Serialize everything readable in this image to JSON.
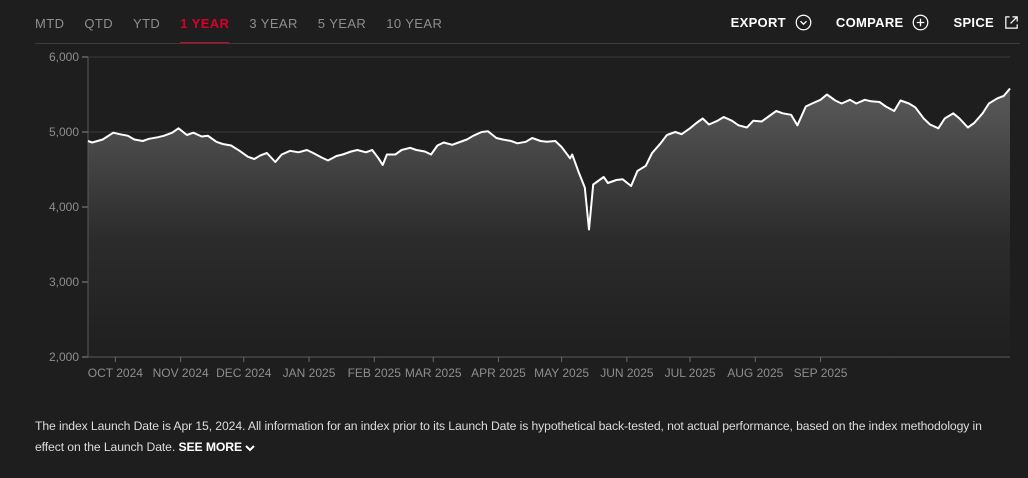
{
  "tabs": [
    {
      "label": "MTD",
      "active": false
    },
    {
      "label": "QTD",
      "active": false
    },
    {
      "label": "YTD",
      "active": false
    },
    {
      "label": "1 YEAR",
      "active": true
    },
    {
      "label": "3 YEAR",
      "active": false
    },
    {
      "label": "5 YEAR",
      "active": false
    },
    {
      "label": "10 YEAR",
      "active": false
    }
  ],
  "actions": [
    {
      "label": "EXPORT",
      "icon": "chevron-down-circle-icon"
    },
    {
      "label": "COMPARE",
      "icon": "plus-circle-icon"
    },
    {
      "label": "SPICE",
      "icon": "external-link-icon"
    }
  ],
  "colors": {
    "accent": "#d6002a",
    "line": "#ffffff",
    "background": "#1e1e1e"
  },
  "chart_data": {
    "type": "area",
    "title": "",
    "xlabel": "",
    "ylabel": "",
    "ylim": [
      2000,
      6000
    ],
    "yticks": [
      2000,
      3000,
      4000,
      5000,
      6000
    ],
    "ytick_labels": [
      "2,000",
      "3,000",
      "4,000",
      "5,000",
      "6,000"
    ],
    "xticks": [
      {
        "label": "OCT 2024",
        "date": "2024-10-01"
      },
      {
        "label": "NOV 2024",
        "date": "2024-11-01"
      },
      {
        "label": "DEC 2024",
        "date": "2024-12-01"
      },
      {
        "label": "JAN 2025",
        "date": "2025-01-01"
      },
      {
        "label": "FEB 2025",
        "date": "2025-02-01"
      },
      {
        "label": "MAR 2025",
        "date": "2025-03-01"
      },
      {
        "label": "APR 2025",
        "date": "2025-04-01"
      },
      {
        "label": "MAY 2025",
        "date": "2025-05-01"
      },
      {
        "label": "JUN 2025",
        "date": "2025-06-01"
      },
      {
        "label": "JUL 2025",
        "date": "2025-07-01"
      },
      {
        "label": "AUG 2025",
        "date": "2025-08-01"
      },
      {
        "label": "SEP 2025",
        "date": "2025-09-01"
      }
    ],
    "grid": "horizontal",
    "series": [
      {
        "points": [
          [
            "2024-09-18",
            4880
          ],
          [
            "2024-09-20",
            4860
          ],
          [
            "2024-09-25",
            4900
          ],
          [
            "2024-09-30",
            4990
          ],
          [
            "2024-10-03",
            4970
          ],
          [
            "2024-10-07",
            4950
          ],
          [
            "2024-10-10",
            4900
          ],
          [
            "2024-10-14",
            4880
          ],
          [
            "2024-10-17",
            4910
          ],
          [
            "2024-10-21",
            4930
          ],
          [
            "2024-10-24",
            4950
          ],
          [
            "2024-10-28",
            4990
          ],
          [
            "2024-10-31",
            5050
          ],
          [
            "2024-11-04",
            4960
          ],
          [
            "2024-11-07",
            4990
          ],
          [
            "2024-11-11",
            4940
          ],
          [
            "2024-11-14",
            4950
          ],
          [
            "2024-11-18",
            4870
          ],
          [
            "2024-11-21",
            4840
          ],
          [
            "2024-11-25",
            4820
          ],
          [
            "2024-11-29",
            4750
          ],
          [
            "2024-12-03",
            4670
          ],
          [
            "2024-12-06",
            4640
          ],
          [
            "2024-12-09",
            4690
          ],
          [
            "2024-12-12",
            4720
          ],
          [
            "2024-12-16",
            4600
          ],
          [
            "2024-12-19",
            4700
          ],
          [
            "2024-12-23",
            4750
          ],
          [
            "2024-12-27",
            4730
          ],
          [
            "2024-12-31",
            4760
          ],
          [
            "2025-01-03",
            4720
          ],
          [
            "2025-01-07",
            4660
          ],
          [
            "2025-01-10",
            4620
          ],
          [
            "2025-01-14",
            4680
          ],
          [
            "2025-01-17",
            4700
          ],
          [
            "2025-01-21",
            4740
          ],
          [
            "2025-01-24",
            4760
          ],
          [
            "2025-01-28",
            4730
          ],
          [
            "2025-01-31",
            4760
          ],
          [
            "2025-02-03",
            4650
          ],
          [
            "2025-02-05",
            4560
          ],
          [
            "2025-02-07",
            4700
          ],
          [
            "2025-02-11",
            4700
          ],
          [
            "2025-02-14",
            4760
          ],
          [
            "2025-02-18",
            4790
          ],
          [
            "2025-02-21",
            4760
          ],
          [
            "2025-02-25",
            4740
          ],
          [
            "2025-02-28",
            4700
          ],
          [
            "2025-03-03",
            4820
          ],
          [
            "2025-03-06",
            4860
          ],
          [
            "2025-03-10",
            4830
          ],
          [
            "2025-03-13",
            4860
          ],
          [
            "2025-03-17",
            4900
          ],
          [
            "2025-03-20",
            4950
          ],
          [
            "2025-03-24",
            5000
          ],
          [
            "2025-03-27",
            5010
          ],
          [
            "2025-03-31",
            4920
          ],
          [
            "2025-04-03",
            4900
          ],
          [
            "2025-04-07",
            4880
          ],
          [
            "2025-04-10",
            4850
          ],
          [
            "2025-04-14",
            4870
          ],
          [
            "2025-04-17",
            4920
          ],
          [
            "2025-04-21",
            4880
          ],
          [
            "2025-04-24",
            4870
          ],
          [
            "2025-04-28",
            4880
          ],
          [
            "2025-05-01",
            4800
          ],
          [
            "2025-05-05",
            4650
          ],
          [
            "2025-05-06",
            4700
          ],
          [
            "2025-05-09",
            4470
          ],
          [
            "2025-05-12",
            4260
          ],
          [
            "2025-05-14",
            3700
          ],
          [
            "2025-05-16",
            4300
          ],
          [
            "2025-05-19",
            4360
          ],
          [
            "2025-05-21",
            4400
          ],
          [
            "2025-05-23",
            4320
          ],
          [
            "2025-05-27",
            4360
          ],
          [
            "2025-05-30",
            4370
          ],
          [
            "2025-06-03",
            4280
          ],
          [
            "2025-06-06",
            4480
          ],
          [
            "2025-06-10",
            4550
          ],
          [
            "2025-06-13",
            4720
          ],
          [
            "2025-06-17",
            4850
          ],
          [
            "2025-06-20",
            4960
          ],
          [
            "2025-06-24",
            5000
          ],
          [
            "2025-06-27",
            4970
          ],
          [
            "2025-07-01",
            5050
          ],
          [
            "2025-07-04",
            5120
          ],
          [
            "2025-07-07",
            5180
          ],
          [
            "2025-07-10",
            5100
          ],
          [
            "2025-07-14",
            5150
          ],
          [
            "2025-07-17",
            5200
          ],
          [
            "2025-07-21",
            5150
          ],
          [
            "2025-07-24",
            5090
          ],
          [
            "2025-07-28",
            5060
          ],
          [
            "2025-07-31",
            5150
          ],
          [
            "2025-08-04",
            5140
          ],
          [
            "2025-08-07",
            5200
          ],
          [
            "2025-08-11",
            5280
          ],
          [
            "2025-08-14",
            5250
          ],
          [
            "2025-08-18",
            5230
          ],
          [
            "2025-08-21",
            5090
          ],
          [
            "2025-08-25",
            5340
          ],
          [
            "2025-08-28",
            5380
          ],
          [
            "2025-09-01",
            5430
          ],
          [
            "2025-09-04",
            5500
          ],
          [
            "2025-09-08",
            5420
          ],
          [
            "2025-09-11",
            5380
          ],
          [
            "2025-09-15",
            5430
          ],
          [
            "2025-09-18",
            5380
          ],
          [
            "2025-09-22",
            5430
          ],
          [
            "2025-09-25",
            5410
          ],
          [
            "2025-09-29",
            5400
          ],
          [
            "2025-10-02",
            5340
          ],
          [
            "2025-10-06",
            5280
          ],
          [
            "2025-10-09",
            5420
          ],
          [
            "2025-10-13",
            5380
          ],
          [
            "2025-10-16",
            5330
          ],
          [
            "2025-10-20",
            5180
          ],
          [
            "2025-10-23",
            5100
          ],
          [
            "2025-10-27",
            5050
          ],
          [
            "2025-10-30",
            5180
          ],
          [
            "2025-11-03",
            5250
          ],
          [
            "2025-11-06",
            5180
          ],
          [
            "2025-11-10",
            5060
          ],
          [
            "2025-11-13",
            5120
          ],
          [
            "2025-11-17",
            5250
          ],
          [
            "2025-11-20",
            5380
          ],
          [
            "2025-11-24",
            5450
          ],
          [
            "2025-11-27",
            5480
          ],
          [
            "2025-11-30",
            5580
          ]
        ]
      }
    ]
  },
  "footnote": {
    "text": "The index Launch Date is Apr 15, 2024. All information for an index prior to its Launch Date is hypothetical back-tested, not actual performance, based on the index methodology in effect on the Launch Date.",
    "see_more": "SEE MORE"
  }
}
